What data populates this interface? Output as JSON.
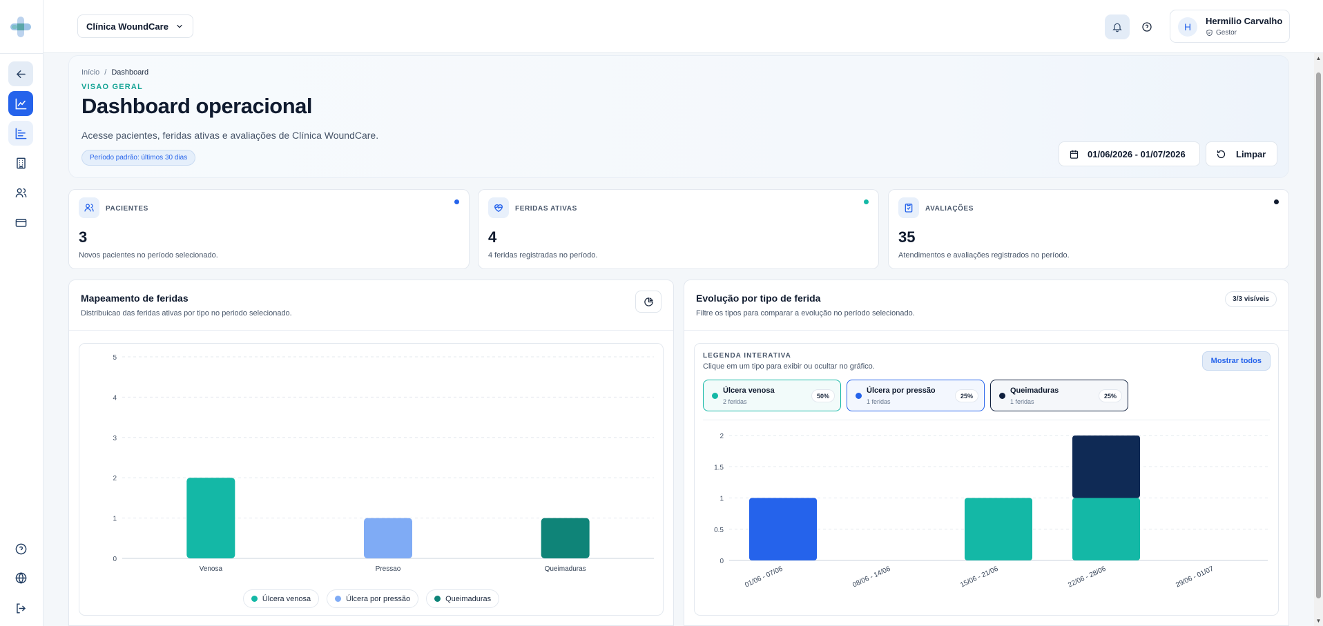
{
  "topbar": {
    "clinic": "Clínica WoundCare",
    "user_initial": "H",
    "user_name": "Hermilio Carvalho",
    "user_role": "Gestor"
  },
  "breadcrumb": {
    "home": "Início",
    "sep": "/",
    "current": "Dashboard"
  },
  "hero": {
    "eyebrow": "VISAO GERAL",
    "title": "Dashboard operacional",
    "subtitle": "Acesse pacientes, feridas ativas e avaliações de Clínica WoundCare.",
    "period_badge": "Período padrão: últimos 30 dias",
    "date_range": "01/06/2026 - 01/07/2026",
    "clear_label": "Limpar"
  },
  "stats": [
    {
      "label": "PACIENTES",
      "value": "3",
      "desc": "Novos pacientes no período selecionado.",
      "dot_color": "#2563eb"
    },
    {
      "label": "FERIDAS ATIVAS",
      "value": "4",
      "desc": "4 feridas registradas no período.",
      "dot_color": "#14b8a6"
    },
    {
      "label": "AVALIAÇÕES",
      "value": "35",
      "desc": "Atendimentos e avaliações registrados no período.",
      "dot_color": "#0f1a2e"
    }
  ],
  "mapping": {
    "title": "Mapeamento de feridas",
    "subtitle": "Distribuicao das feridas ativas por tipo no periodo selecionado.",
    "legend": [
      "Úlcera venosa",
      "Úlcera por pressão",
      "Queimaduras"
    ]
  },
  "evolution": {
    "title": "Evolução por tipo de ferida",
    "subtitle": "Filtre os tipos para comparar a evolução no período selecionado.",
    "visible_badge": "3/3 visíveis",
    "legend_title": "LEGENDA INTERATIVA",
    "legend_sub": "Clique em um tipo para exibir ou ocultar no gráfico.",
    "show_all": "Mostrar todos",
    "types": [
      {
        "name": "Úlcera venosa",
        "count": "2 feridas",
        "pct": "50%",
        "color": "#14b8a6"
      },
      {
        "name": "Úlcera por pressão",
        "count": "1 feridas",
        "pct": "25%",
        "color": "#2563eb"
      },
      {
        "name": "Queimaduras",
        "count": "1 feridas",
        "pct": "25%",
        "color": "#0f1f3d"
      }
    ]
  },
  "chart_data": [
    {
      "type": "bar",
      "categories": [
        "Venosa",
        "Pressao",
        "Queimaduras"
      ],
      "values": [
        2,
        1,
        1
      ],
      "colors": [
        "#14b8a6",
        "#7fabf5",
        "#0f8478"
      ],
      "ylim": [
        0,
        5
      ],
      "yticks": [
        "0",
        "1",
        "2",
        "3",
        "4",
        "5"
      ],
      "grid": true,
      "legend_placement": "bottom"
    },
    {
      "type": "bar",
      "stacked": true,
      "categories": [
        "01/06 - 07/06",
        "08/06 - 14/06",
        "15/06 - 21/06",
        "22/06 - 28/06",
        "29/06 - 01/07"
      ],
      "series": [
        {
          "name": "Úlcera venosa",
          "values": [
            0,
            0,
            1,
            1,
            0
          ],
          "color": "#14b8a6"
        },
        {
          "name": "Úlcera por pressão",
          "values": [
            1,
            0,
            0,
            0,
            0
          ],
          "color": "#2563eb"
        },
        {
          "name": "Queimaduras",
          "values": [
            0,
            0,
            0,
            1,
            0
          ],
          "color": "#0f2a55"
        }
      ],
      "ylim": [
        0,
        2
      ],
      "yticks": [
        "0",
        "0.5",
        "1",
        "1.5",
        "2"
      ],
      "grid": true,
      "legend_placement": "top"
    }
  ]
}
